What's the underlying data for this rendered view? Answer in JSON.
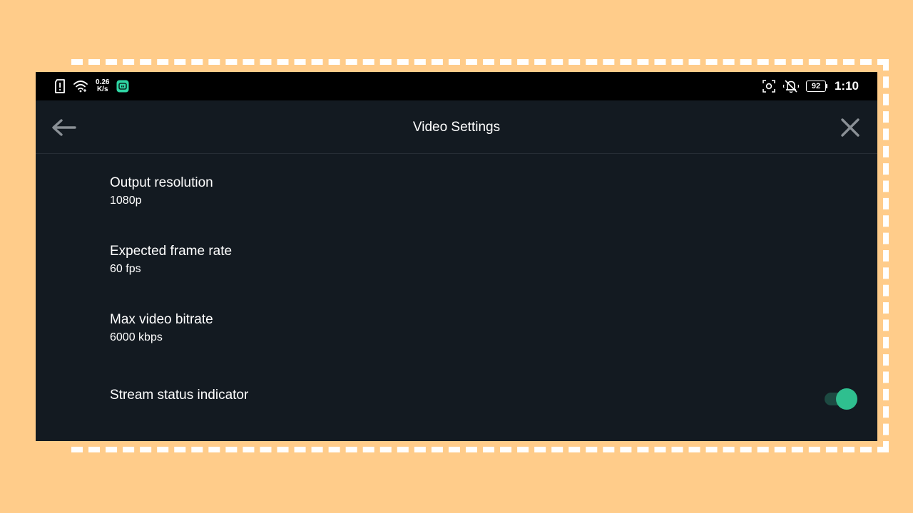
{
  "statusbar": {
    "net_speed_value": "0.26",
    "net_speed_unit": "K/s",
    "battery_level": "92",
    "time": "1:10",
    "icons": {
      "sim": "sim-alert-icon",
      "wifi": "wifi-icon",
      "app": "app-notification-icon",
      "screenshot": "screenshot-icon",
      "mute": "notifications-off-icon"
    }
  },
  "appbar": {
    "title": "Video Settings",
    "back_icon": "arrow-left-icon",
    "close_icon": "close-icon"
  },
  "settings": [
    {
      "title": "Output resolution",
      "value": "1080p"
    },
    {
      "title": "Expected frame rate",
      "value": "60 fps"
    },
    {
      "title": "Max video bitrate",
      "value": "6000 kbps"
    },
    {
      "title": "Stream status indicator",
      "toggle_on": true
    }
  ],
  "colors": {
    "background": "#ffcc8a",
    "screen": "#131a21",
    "accent": "#2fbf8f"
  }
}
